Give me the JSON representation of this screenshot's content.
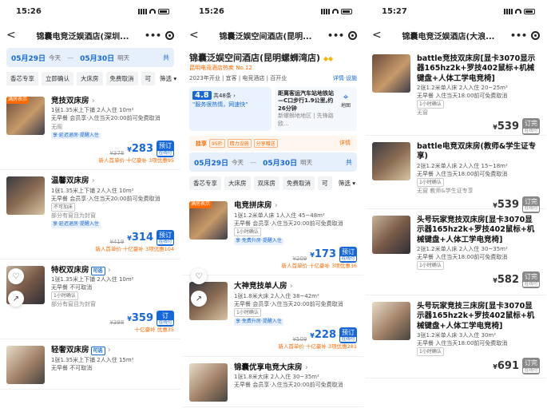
{
  "status": {
    "s1_time": "15:26",
    "s2_time": "15:26",
    "s3_time": "15:27"
  },
  "colors": {
    "accent": "#1668d8",
    "promo": "#ff6a00"
  },
  "screen1": {
    "title": "锦囊电竞泛娱酒店(深圳...",
    "checkin": "05月29日",
    "checkin_day": "今天",
    "checkout": "05月30日",
    "checkout_day": "明天",
    "count": "共",
    "filters": [
      "香芯专享",
      "立即确认",
      "大床房",
      "免费取消",
      "可"
    ],
    "filter_btn": "筛选",
    "rooms": [
      {
        "tag": "满房表示",
        "name": "竞技双床房",
        "desc": "1张1.35米上下铺 2人入住 10m²",
        "policy": "无早餐 会员享·入住当天20:00前可免费取消",
        "extra": "无阁",
        "perk": "享·延迟退房·提醒入住",
        "old": "¥378",
        "price": "283",
        "promo": "新人首单价·十亿豪补 3项优惠95",
        "book": "预订",
        "pay": "在线付"
      },
      {
        "name": "温馨双床房",
        "desc": "1张1.35米上下铺 2人入住 10m²",
        "policy": "无早餐 会员享·入住当天20:00前可免费取消",
        "conf": "不可加床",
        "extra": "部分有窗且为封窗",
        "perk": "享·延迟退房·提醒入住",
        "old": "¥419",
        "price": "314",
        "promo": "新人首单价·十亿豪补 3项优惠104",
        "book": "预订",
        "pay": "在线付"
      },
      {
        "name": "特权双床房",
        "pill": "可选",
        "desc": "1张1.35米上下铺 2人入住 10m²",
        "policy": "无早餐 不可取消",
        "conf": "1小时确认",
        "extra": "部分有窗且为封窗",
        "old": "¥398",
        "price": "359",
        "promo": "十亿豪补 优惠35",
        "book": "订",
        "pay": "在线付"
      },
      {
        "name": "轻奢双床房",
        "pill": "可选",
        "desc": "1张1.35米上下铺 2人入住 15m²",
        "policy": "无早餐 不可取消"
      }
    ]
  },
  "screen2": {
    "title": "锦囊泛娱空间酒店(昆明...",
    "hotel_name": "锦囊泛娱空间酒店(昆明螺蛳湾店)",
    "rank": "昆明电竞酒店热卖 No.12",
    "meta_left": "2023年开业 | 宜客 | 电竞酒店 | 百开业",
    "meta_right": "详情·设施",
    "score": "4.8",
    "reviews": "共48条",
    "review": "\"服务很热情，网速快\"",
    "nearby": "距离客运汽车站地铁站—C口步行1.9公里,约26分钟",
    "area": "新螺蛳地地区 | 先锋路欧...",
    "map": "地图",
    "benefit_h": "挂享",
    "benefit_tags": [
      "95折",
      "精力设施",
      "分享赠送"
    ],
    "benefit_r": "详情",
    "checkin": "05月29日",
    "checkin_day": "今天",
    "checkout": "05月30日",
    "checkout_day": "明天",
    "count": "共",
    "filters": [
      "香芯专享",
      "大床房",
      "双床房",
      "免费取消",
      "可"
    ],
    "filter_btn": "筛选",
    "rooms": [
      {
        "tag": "满房表示",
        "name": "电竞拼床房",
        "desc": "1张1.2米单人床 1人入住 45~48m²",
        "policy": "无早餐 会员享·入住当天20:00前可免费取消",
        "conf": "1小时确认",
        "perk": "享·免费升房·提醒入住",
        "old": "¥209",
        "price": "173",
        "promo": "新人首单价·十亿豪补 3项优惠36",
        "book": "预订",
        "pay": "在线付"
      },
      {
        "name": "大神竞技单人房",
        "desc": "1张1.8米大床 2人入住 38~42m²",
        "policy": "无早餐 会员享·入住当天20:00前可免费取消",
        "conf": "1小时确认",
        "perk": "享·免费升房·提醒入住",
        "old": "¥509",
        "price": "228",
        "promo": "新人首单价·十亿豪补 3项优惠281",
        "book": "预订",
        "pay": "在线付"
      },
      {
        "name": "锦囊优享电竞大床房",
        "desc": "1张1.8米大床 2人入住 30~35m²",
        "policy": "无早餐 会员享·入住当天20:00前可免费取消"
      }
    ]
  },
  "screen3": {
    "title": "锦囊电竞泛娱酒店(大浪...",
    "rooms": [
      {
        "name": "battle竞技双床房[显卡3070显示器165hz2k+罗技402鼠标+机械键盘+人体工学电竞椅]",
        "desc": "2张1.2米单人床 2人入住 20~25m²",
        "policy": "无早餐 入住当天18:00前可免费取消",
        "conf": "1小时确认",
        "extra": "无窗",
        "price": "539",
        "book": "订完",
        "pay": "在线付"
      },
      {
        "name": "battle电竞双床房(教师&学生证专享)",
        "desc": "2张1.2米单人床 2人入住 15~18m²",
        "policy": "无早餐 入住当天18:00前可免费取消",
        "conf": "1小时确认",
        "extra": "无窗 教师&学生证专享",
        "price": "539",
        "book": "订完",
        "pay": "在线付"
      },
      {
        "name": "头号玩家竞技双床房[显卡3070显示器165hz2k+罗技402鼠标+机械键盘+人体工学电竞椅]",
        "desc": "2张1.2米单人床 2人入住 30~35m²",
        "policy": "无早餐 入住当天18:00前可免费取消",
        "conf": "1小时确认",
        "price": "582",
        "book": "订完",
        "pay": "在线付"
      },
      {
        "name": "头号玩家竞技三床房[显卡3070显示器165hz2k+罗技402鼠标+机械键盘+人体工学电竞椅]",
        "desc": "3张1.2米单人床 3人入住 30m²",
        "policy": "无早餐 入住当天18:00前可免费取消",
        "conf": "1小时确认",
        "price": "691",
        "book": "订完",
        "pay": "在线付"
      }
    ]
  }
}
